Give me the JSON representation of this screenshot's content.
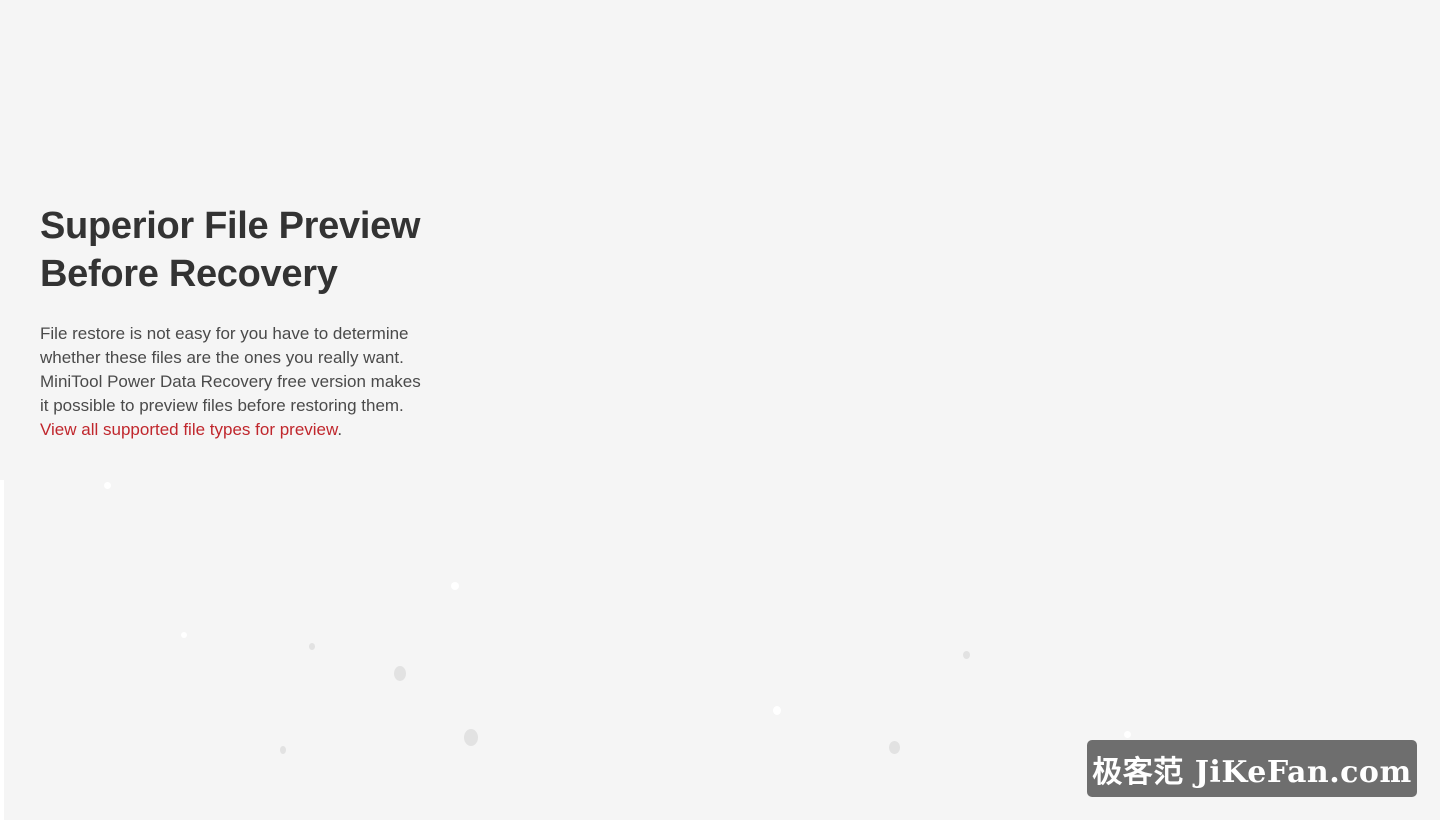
{
  "hero": {
    "title_line1": "Superior File Preview",
    "title_line2": "Before Recovery",
    "description": "File restore is not easy for you have to determine whether these files are the ones you really want. MiniTool Power Data Recovery free version makes it possible to preview files before restoring them. ",
    "link_text": "View all supported file types for preview",
    "trailing": "."
  },
  "watermark": {
    "text": "极客范 JiKeFan.com"
  },
  "colors": {
    "background": "#f5f5f5",
    "heading": "#333333",
    "body_text": "#4a4a4a",
    "link": "#c0272d",
    "watermark_bg": "#6e6e6e"
  }
}
